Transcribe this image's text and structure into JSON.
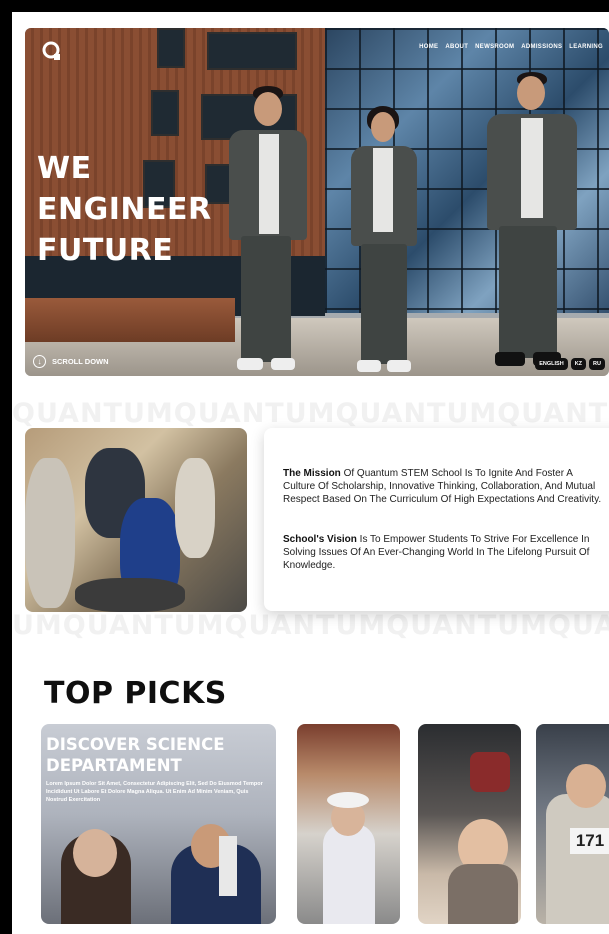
{
  "nav": {
    "items": [
      "HOME",
      "ABOUT",
      "NEWSROOM",
      "ADMISSIONS",
      "LEARNING"
    ]
  },
  "hero": {
    "headline": [
      "WE",
      "ENGINEER",
      "FUTURE"
    ],
    "scroll_label": "SCROLL DOWN",
    "languages": [
      "ENGLISH",
      "KZ",
      "RU"
    ]
  },
  "watermark": {
    "top": "QUANTUMQUANTUMQUANTUMQUANTUM",
    "bottom": "UMQUANTUMQUANTUMQUANTUMQUANTU"
  },
  "mission": {
    "mission_title": "The Mission",
    "mission_text": " Of Quantum STEM School Is To Ignite And Foster A Culture Of Scholarship, Innovative Thinking, Collaboration, And Mutual Respect Based On The Curriculum Of High Expectations And Creativity.",
    "vision_title": "School's Vision",
    "vision_text": " Is To Empower Students To Strive For Excellence In Solving Issues Of An Ever-Changing World In The Lifelong Pursuit Of Knowledge."
  },
  "top_picks": {
    "title": "TOP PICKS",
    "featured": {
      "title_line1": "DISCOVER SCIENCE",
      "title_line2": "DEPARTAMENT",
      "desc": "Lorem Ipsum Dolor Sit Amet, Consectetur Adipiscing Elit, Sed Do Eiusmod Tempor Incididunt Ut Labore Et Dolore Magna Aliqua. Ut Enim Ad Minim Veniam, Quis Nostrud Exercitation"
    },
    "badge_number": "171"
  },
  "colors": {
    "accent_text": "#ffffff",
    "page_bg": "#ffffff",
    "frame": "#000000"
  }
}
